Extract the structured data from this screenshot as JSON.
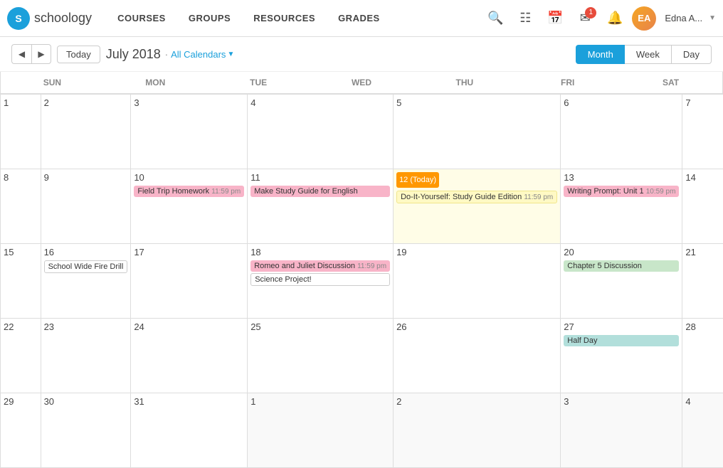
{
  "nav": {
    "logo_letter": "S",
    "logo_text": "schoology",
    "links": [
      "COURSES",
      "GROUPS",
      "RESOURCES",
      "GRADES"
    ],
    "notification_count": "1",
    "user_name": "Edna A...",
    "avatar_initials": "EA"
  },
  "toolbar": {
    "today_label": "Today",
    "month_title": "July 2018",
    "filter_label": "All Calendars",
    "views": [
      "Month",
      "Week",
      "Day"
    ],
    "active_view": "Month"
  },
  "calendar": {
    "days": [
      "Sun",
      "Mon",
      "Tue",
      "Wed",
      "Thu",
      "Fri",
      "Sat"
    ],
    "weeks": [
      [
        {
          "date": "1",
          "events": []
        },
        {
          "date": "2",
          "events": []
        },
        {
          "date": "3",
          "events": []
        },
        {
          "date": "4",
          "events": []
        },
        {
          "date": "5",
          "events": []
        },
        {
          "date": "6",
          "events": []
        },
        {
          "date": "7",
          "events": []
        }
      ],
      [
        {
          "date": "8",
          "events": []
        },
        {
          "date": "9",
          "events": []
        },
        {
          "date": "10",
          "events": [
            {
              "label": "Field Trip Homework",
              "time": "11:59 pm",
              "type": "pink"
            }
          ]
        },
        {
          "date": "11",
          "events": [
            {
              "label": "Make Study Guide for English",
              "time": "",
              "type": "pink"
            }
          ]
        },
        {
          "date": "12",
          "today": true,
          "events": [
            {
              "label": "Do-It-Yourself: Study Guide Edition",
              "time": "11:59 pm",
              "type": "yellow"
            }
          ]
        },
        {
          "date": "13",
          "events": [
            {
              "label": "Writing Prompt: Unit 1",
              "time": "10:59 pm",
              "type": "pink"
            }
          ]
        },
        {
          "date": "14",
          "events": []
        }
      ],
      [
        {
          "date": "15",
          "events": []
        },
        {
          "date": "16",
          "events": [
            {
              "label": "School Wide Fire Drill",
              "time": "",
              "type": "outline"
            }
          ]
        },
        {
          "date": "17",
          "events": []
        },
        {
          "date": "18",
          "events": [
            {
              "label": "Romeo and Juliet Discussion",
              "time": "11:59 pm",
              "type": "pink"
            },
            {
              "label": "Science Project!",
              "time": "",
              "type": "outline"
            }
          ]
        },
        {
          "date": "19",
          "events": []
        },
        {
          "date": "20",
          "events": [
            {
              "label": "Chapter 5 Discussion",
              "time": "",
              "type": "green"
            }
          ]
        },
        {
          "date": "21",
          "events": []
        }
      ],
      [
        {
          "date": "22",
          "events": []
        },
        {
          "date": "23",
          "events": []
        },
        {
          "date": "24",
          "events": []
        },
        {
          "date": "25",
          "events": []
        },
        {
          "date": "26",
          "events": []
        },
        {
          "date": "27",
          "events": [
            {
              "label": "Half Day",
              "time": "",
              "type": "teal"
            }
          ]
        },
        {
          "date": "28",
          "events": []
        }
      ],
      [
        {
          "date": "29",
          "events": []
        },
        {
          "date": "30",
          "events": []
        },
        {
          "date": "31",
          "events": []
        },
        {
          "date": "1",
          "other": true,
          "events": []
        },
        {
          "date": "2",
          "other": true,
          "events": []
        },
        {
          "date": "3",
          "other": true,
          "events": []
        },
        {
          "date": "4",
          "other": true,
          "events": []
        }
      ]
    ]
  }
}
